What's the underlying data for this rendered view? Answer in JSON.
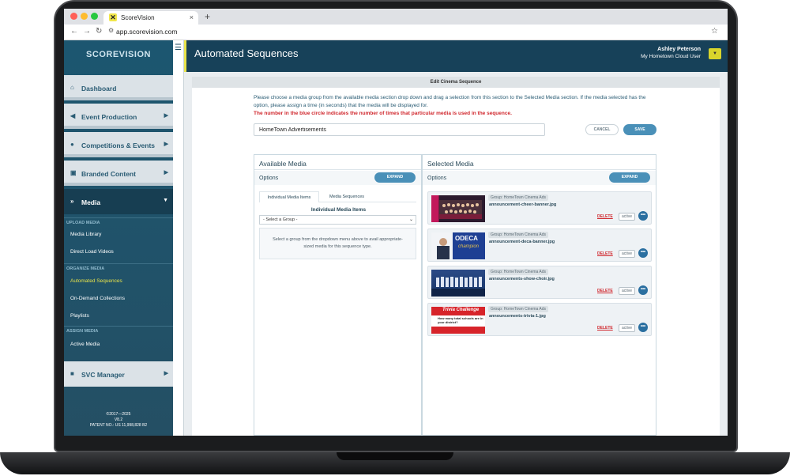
{
  "browser": {
    "tab_title": "ScoreVision",
    "tab_close": "×",
    "new_tab": "+",
    "url": "app.scorevision.com"
  },
  "sidebar": {
    "logo_text": "SCOREVISION",
    "items": [
      {
        "label": "Dashboard",
        "icon": "home-icon"
      },
      {
        "label": "Event Production",
        "icon": "megaphone-icon"
      },
      {
        "label": "Competitions & Events",
        "icon": "ball-icon"
      },
      {
        "label": "Branded Content",
        "icon": "content-icon"
      },
      {
        "label": "Media",
        "icon": "fast-forward-icon"
      }
    ],
    "sections": [
      {
        "heading": "UPLOAD MEDIA",
        "items": [
          "Media Library",
          "Direct Load Videos"
        ]
      },
      {
        "heading": "ORGANIZE MEDIA",
        "items": [
          "Automated Sequences",
          "On-Demand Collections",
          "Playlists"
        ]
      },
      {
        "heading": "ASSIGN MEDIA",
        "items": [
          "Active Media"
        ]
      }
    ],
    "svc_manager": "SVC Manager",
    "footer": {
      "years": "©2017—2025",
      "version": "V8.2",
      "patent": "PATENT NO.: US 11,998,828 B2"
    }
  },
  "header": {
    "title": "Automated Sequences",
    "user_name": "Ashley Peterson",
    "user_org": "My Hometown Cloud User"
  },
  "panel": {
    "heading": "Edit Cinema Sequence",
    "instructions": "Please choose a media group from the available media section drop down and drag a selection from this section to the Selected Media section. If the media selected has the option, please assign a time (in seconds) that the media will be displayed for.",
    "warning": "The number in the blue circle indicates the number of times that particular media is used in the sequence.",
    "sequence_name": "HomeTown Advertisements",
    "cancel_label": "CANCEL",
    "save_label": "SAVE"
  },
  "available": {
    "title": "Available Media",
    "options_label": "Options",
    "expand_label": "EXPAND",
    "tabs": [
      "Individual Media Items",
      "Media Sequences"
    ],
    "section_title": "Individual Media Items",
    "select_placeholder": "- Select a Group -",
    "hint": "Select a group from the dropdown menu above to avail appropriate-sized media for this sequence type."
  },
  "selected": {
    "title": "Selected Media",
    "options_label": "Options",
    "expand_label": "EXPAND",
    "items": [
      {
        "group": "Group: HomeTown Cinema Ads",
        "file": "announcement-cheer-banner.jpg",
        "delete": "DELETE",
        "status": "active",
        "count": "•••"
      },
      {
        "group": "Group: HomeTown Cinema Ads",
        "file": "announcement-deca-banner.jpg",
        "delete": "DELETE",
        "status": "active",
        "count": "•••"
      },
      {
        "group": "Group: HomeTown Cinema Ads",
        "file": "announcements-show-choir.jpg",
        "delete": "DELETE",
        "status": "active",
        "count": "•••"
      },
      {
        "group": "Group: HomeTown Cinema Ads",
        "file": "announcements-trivia-1.jpg",
        "delete": "DELETE",
        "status": "active",
        "count": "•••"
      }
    ],
    "thumb_texts": {
      "deca": "ODECA",
      "deca_sub": "champion",
      "trivia": "Trivia Challenge",
      "trivia_q": "How many total schools are in your district?"
    }
  },
  "colors": {
    "brand_dark": "#174159",
    "accent_yellow": "#e8e34a",
    "button_blue": "#4a90b8",
    "delete_red": "#d0262c"
  }
}
